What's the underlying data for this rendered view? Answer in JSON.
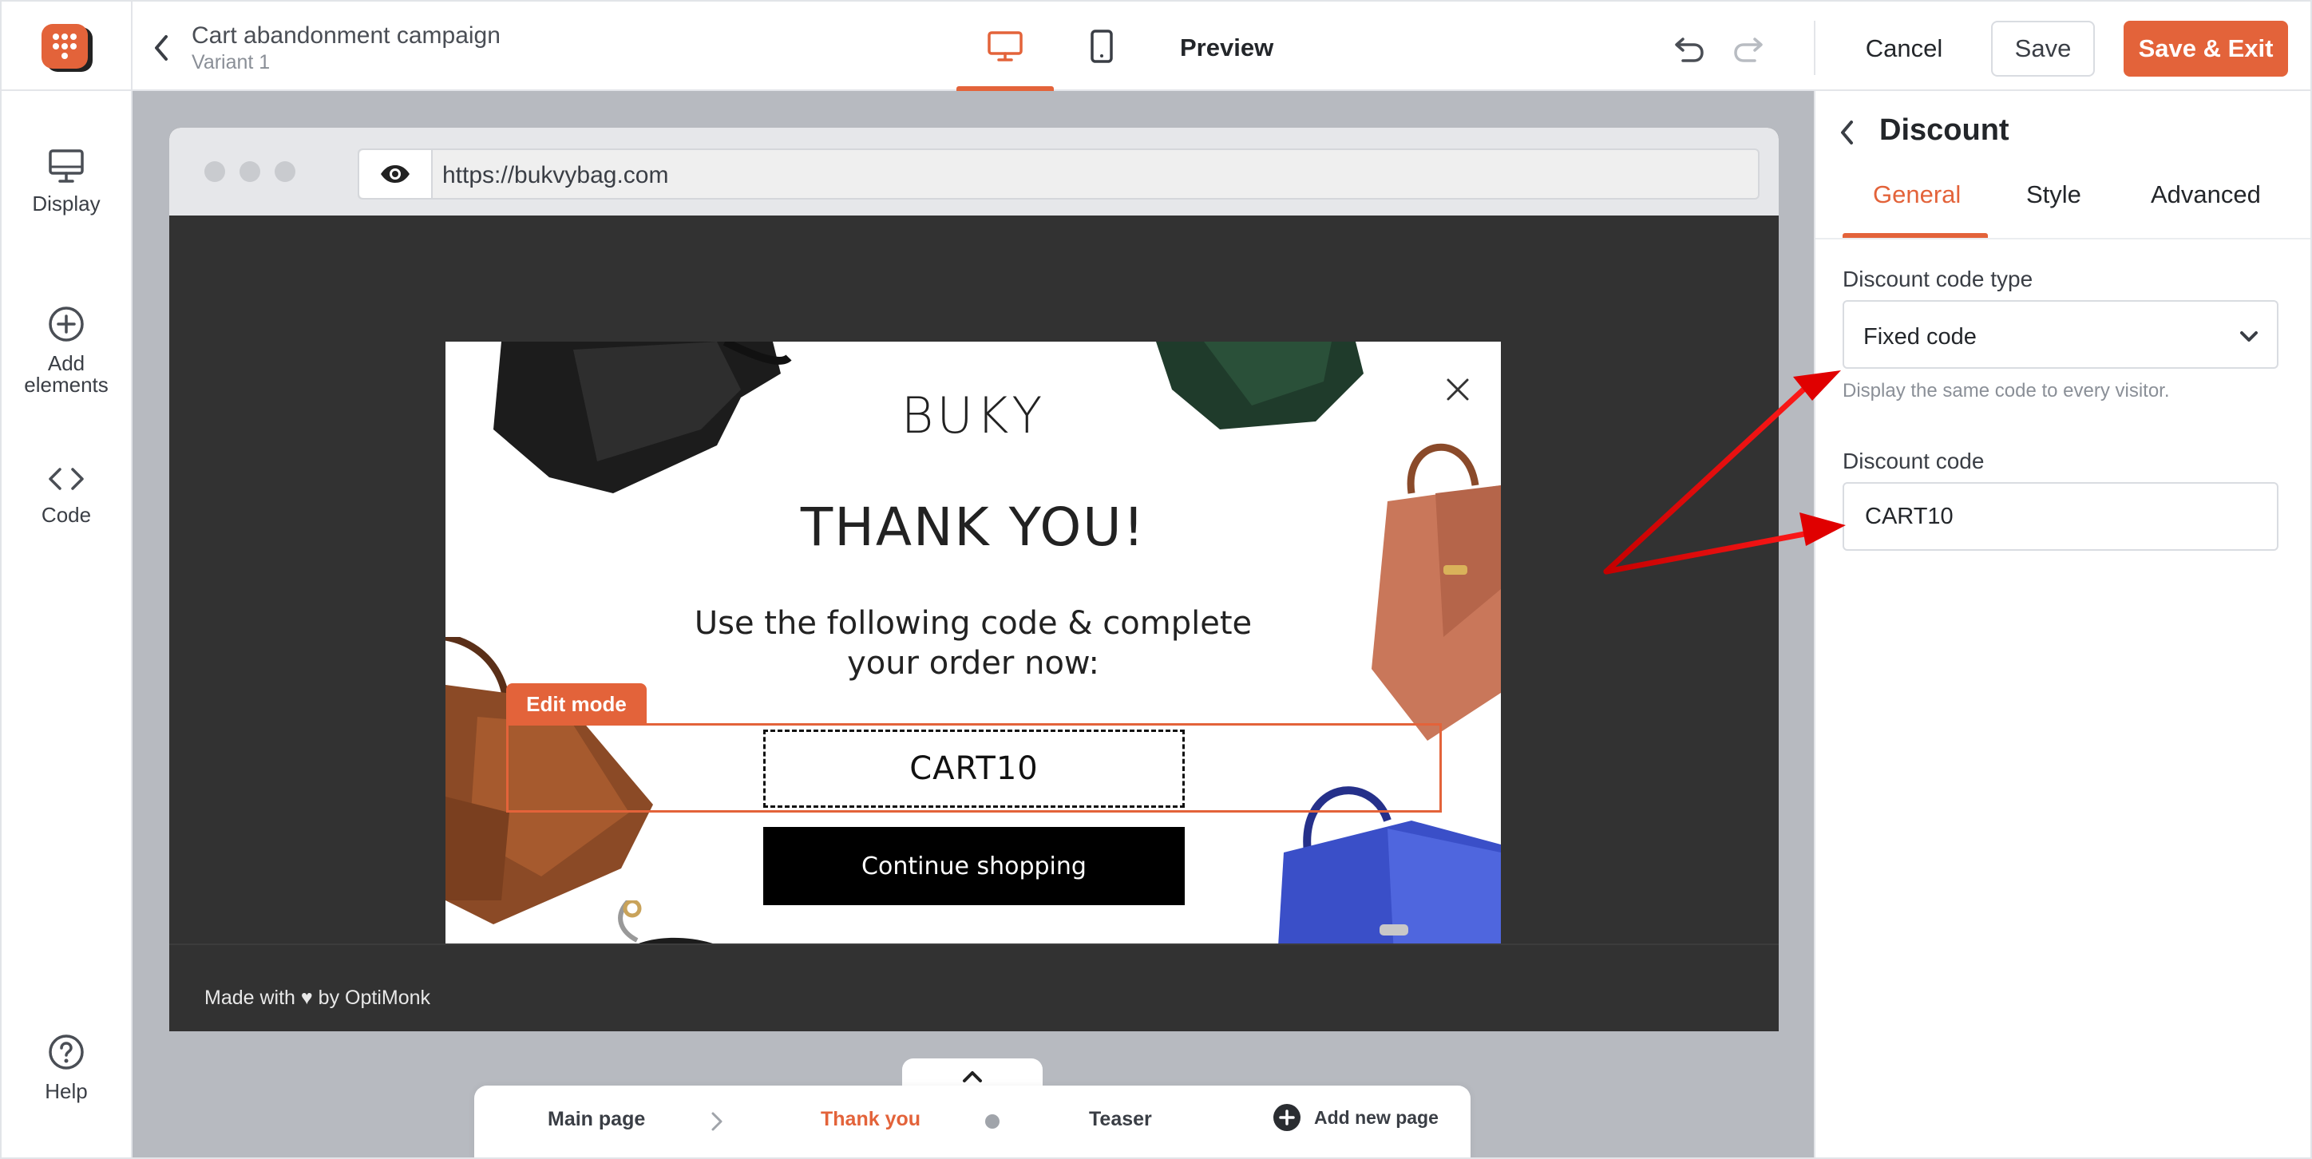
{
  "app": {
    "campaign_title": "Cart abandonment campaign",
    "variant": "Variant 1",
    "preview_label": "Preview",
    "cancel_label": "Cancel",
    "save_label": "Save",
    "save_exit_label": "Save & Exit",
    "accent_color": "#e3633a"
  },
  "sidebar": {
    "items": [
      {
        "label": "Display",
        "icon": "monitor-icon"
      },
      {
        "label": "Add elements",
        "icon": "plus-circle-icon"
      },
      {
        "label": "Code",
        "icon": "code-brackets-icon"
      },
      {
        "label": "Help",
        "icon": "question-circle-icon"
      }
    ]
  },
  "browser": {
    "url": "https://bukvybag.com",
    "footer_text": "Made with ♥ by OptiMonk"
  },
  "popup": {
    "brand": "BUKY",
    "headline": "THANK YOU!",
    "subhead": "Use the following code & complete your order now:",
    "edit_mode_label": "Edit mode",
    "code": "CART10",
    "continue_label": "Continue shopping"
  },
  "pages": {
    "tabs": [
      {
        "label": "Main page",
        "active": false
      },
      {
        "label": "Thank you",
        "active": true
      },
      {
        "label": "Teaser",
        "active": false
      }
    ],
    "add_label": "Add new page"
  },
  "panel": {
    "title": "Discount",
    "tabs": [
      {
        "label": "General",
        "active": true
      },
      {
        "label": "Style",
        "active": false
      },
      {
        "label": "Advanced",
        "active": false
      }
    ],
    "code_type_label": "Discount code type",
    "code_type_value": "Fixed code",
    "code_type_help": "Display the same code to every visitor.",
    "code_label": "Discount code",
    "code_value": "CART10"
  }
}
